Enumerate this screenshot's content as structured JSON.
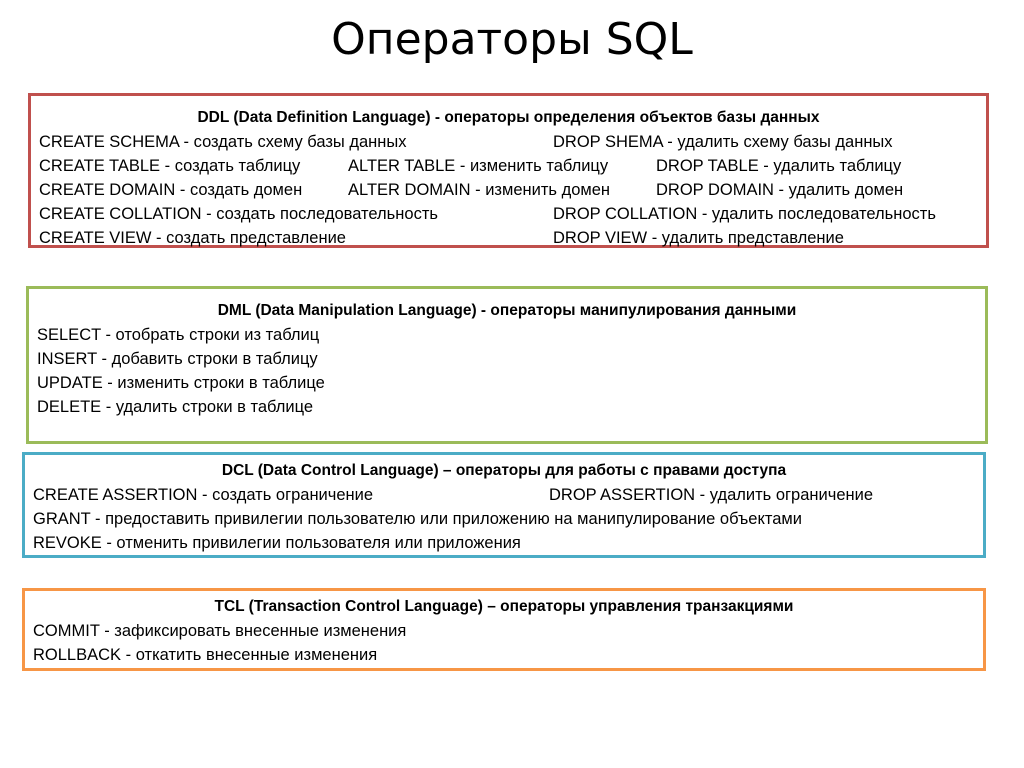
{
  "title": "Операторы SQL",
  "colors": {
    "ddl_border": "#c0504d",
    "dml_border": "#9bbb59",
    "dcl_border": "#4bacc6",
    "tcl_border": "#f79646"
  },
  "ddl": {
    "heading": "DDL (Data Definition Language) - операторы определения объектов базы данных",
    "rows": [
      [
        "CREATE SCHEMA - создать схему базы данных",
        "",
        "DROP SHEMA - удалить схему базы данных"
      ],
      [
        "CREATE TABLE - создать таблицу",
        "ALTER TABLE - изменить таблицу",
        "DROP TABLE - удалить таблицу"
      ],
      [
        "CREATE DOMAIN - создать домен",
        "ALTER DOMAIN - изменить домен",
        "DROP DOMAIN - удалить домен"
      ],
      [
        "CREATE COLLATION - создать последовательность",
        "",
        "DROP COLLATION - удалить последовательность"
      ],
      [
        "CREATE VIEW - создать представление",
        "",
        "DROP VIEW - удалить представление"
      ]
    ]
  },
  "dml": {
    "heading": "DML (Data Manipulation Language) - операторы манипулирования данными",
    "rows": [
      "SELECT - отобрать строки из таблиц",
      "INSERT - добавить строки в таблицу",
      "UPDATE - изменить строки в таблице",
      "DELETE - удалить строки в таблице"
    ]
  },
  "dcl": {
    "heading": "DCL (Data Control Language) – операторы для работы с правами доступа",
    "rows": [
      [
        "CREATE ASSERTION - создать ограничение",
        "DROP ASSERTION - удалить ограничение"
      ],
      [
        "GRANT - предоставить привилегии пользователю или приложению на манипулирование объектами",
        ""
      ],
      [
        "REVOKE - отменить привилегии пользователя или приложения",
        ""
      ]
    ]
  },
  "tcl": {
    "heading": "TCL (Transaction Control Language) – операторы управления транзакциями",
    "rows": [
      "COMMIT - зафиксировать внесенные изменения",
      "ROLLBACK - откатить внесенные изменения"
    ]
  }
}
